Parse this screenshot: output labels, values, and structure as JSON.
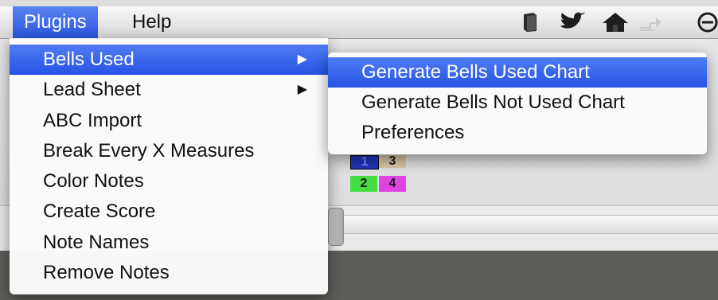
{
  "menubar": {
    "plugins_label": "Plugins",
    "help_label": "Help",
    "status_icons": [
      "book-icon",
      "twitter-bird-icon",
      "home-icon",
      "share-arrow-icon",
      "power-icon"
    ]
  },
  "plugins_menu": {
    "items": [
      {
        "label": "Bells Used",
        "has_submenu": true,
        "highlighted": true
      },
      {
        "label": "Lead Sheet",
        "has_submenu": true,
        "highlighted": false
      },
      {
        "label": "ABC Import",
        "has_submenu": false,
        "highlighted": false
      },
      {
        "label": "Break Every X Measures",
        "has_submenu": false,
        "highlighted": false
      },
      {
        "label": "Color Notes",
        "has_submenu": false,
        "highlighted": false
      },
      {
        "label": "Create Score",
        "has_submenu": false,
        "highlighted": false
      },
      {
        "label": "Note Names",
        "has_submenu": false,
        "highlighted": false
      },
      {
        "label": "Remove Notes",
        "has_submenu": false,
        "highlighted": false
      }
    ],
    "submenu_arrow": "▶"
  },
  "bells_used_submenu": {
    "items": [
      {
        "label": "Generate Bells Used Chart",
        "highlighted": true
      },
      {
        "label": "Generate Bells Not Used Chart",
        "highlighted": false
      },
      {
        "label": "Preferences",
        "highlighted": false
      }
    ]
  },
  "background": {
    "chips": [
      {
        "label": "1",
        "color": "#2233bb"
      },
      {
        "label": "3",
        "color": "#d8c6a6"
      },
      {
        "label": "2",
        "color": "#44dd44"
      },
      {
        "label": "4",
        "color": "#e044e0"
      }
    ]
  },
  "colors": {
    "highlight": "#2b56e0",
    "menubar": "#e6e6e6",
    "dark_area": "#5f5d59"
  }
}
